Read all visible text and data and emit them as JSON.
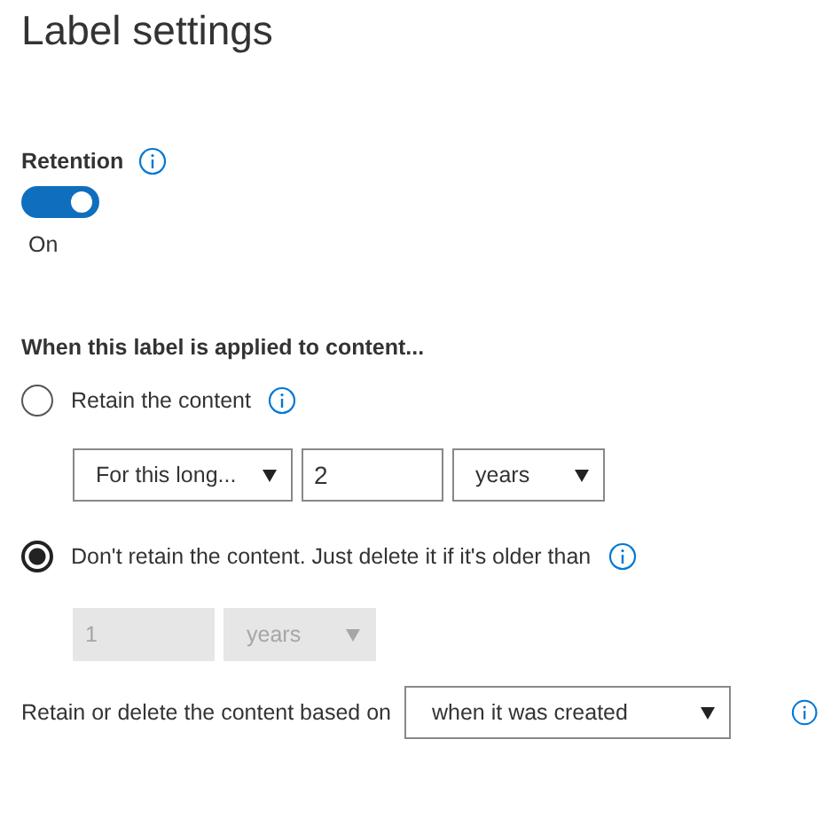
{
  "title": "Label settings",
  "retention": {
    "label": "Retention",
    "on": true,
    "state_label": "On"
  },
  "heading": "When this label is applied to content...",
  "options": [
    {
      "label": "Retain the content",
      "selected": false,
      "controls": [
        {
          "kind": "select",
          "value": "For this long...",
          "disabled": false
        },
        {
          "kind": "input",
          "value": "2",
          "disabled": false
        },
        {
          "kind": "select",
          "value": "years",
          "disabled": false
        }
      ]
    },
    {
      "label": "Don't retain the content. Just delete it if it's older than",
      "selected": true,
      "controls": [
        {
          "kind": "input",
          "value": "1",
          "disabled": true
        },
        {
          "kind": "select",
          "value": "years",
          "disabled": true
        }
      ]
    }
  ],
  "based_on": {
    "label": "Retain or delete the content based on",
    "value": "when it was created"
  }
}
